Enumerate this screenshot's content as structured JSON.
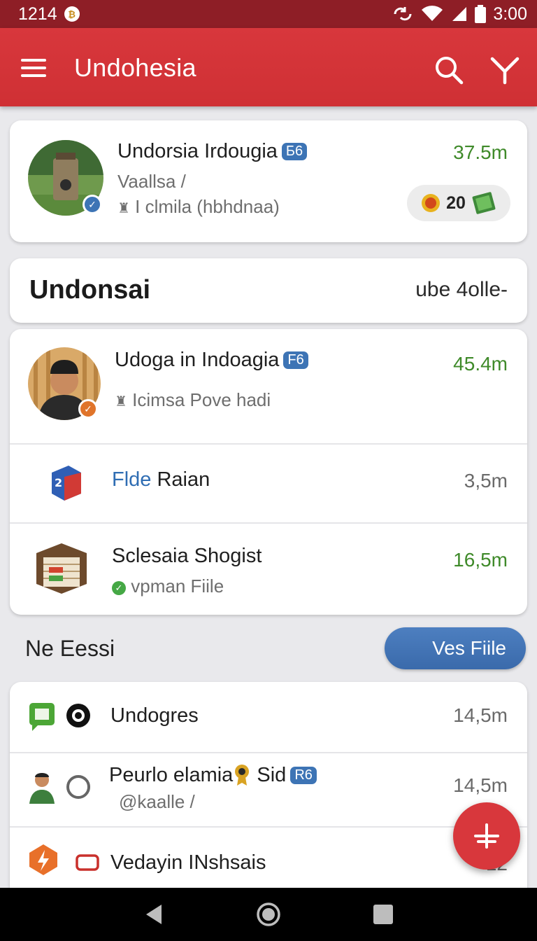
{
  "status_bar": {
    "time_left": "1214",
    "time_right": "3:00"
  },
  "app_bar": {
    "title": "Undohesia"
  },
  "profile_card": {
    "name": "Undorsia Irdougia",
    "tag": "Б6",
    "subtitle": "Vaallsa /",
    "meta": "I clmila (hbhdnaa)",
    "value": "37.5m",
    "pill_count": "20"
  },
  "header_card": {
    "title": "Undonsai",
    "right_text": "ube 4olle-"
  },
  "list_card": {
    "items": [
      {
        "name": "Udoga in Indoagia",
        "tag": "F6",
        "meta": "Icimsa Pove hadi",
        "value": "45.4m"
      },
      {
        "name_accent": "Flde",
        "name_rest": " Raian",
        "value": "3,5m"
      },
      {
        "name": "Sclesaia Shogist",
        "meta": "vpman Fiile",
        "value": "16,5m"
      }
    ]
  },
  "section": {
    "title": "Ne Eessi",
    "button_label": "Ves Fiile"
  },
  "bottom_card": {
    "items": [
      {
        "name": "Undogres",
        "value": "14,5m"
      },
      {
        "name_pre": "Peurlo elamia",
        "name_post": " Sid",
        "tag": "R6",
        "handle": "@kaalle /",
        "value": "14,5m"
      },
      {
        "name": "Vedayin INshsais",
        "value": "12"
      }
    ]
  },
  "colors": {
    "brand": "#d8373c",
    "status": "#8e1e26",
    "accent_blue": "#3d74b5",
    "value_green": "#3f8a2a"
  },
  "icons": [
    "menu-icon",
    "search-icon",
    "filter-icon",
    "verified-icon",
    "trophy-icon",
    "money-icon",
    "cube-icon",
    "crate-icon",
    "check-icon",
    "chat-icon",
    "target-icon",
    "avatar-icon",
    "circle-icon",
    "flame-icon",
    "rect-icon",
    "plus-icon",
    "back-icon",
    "home-icon",
    "recents-icon"
  ]
}
